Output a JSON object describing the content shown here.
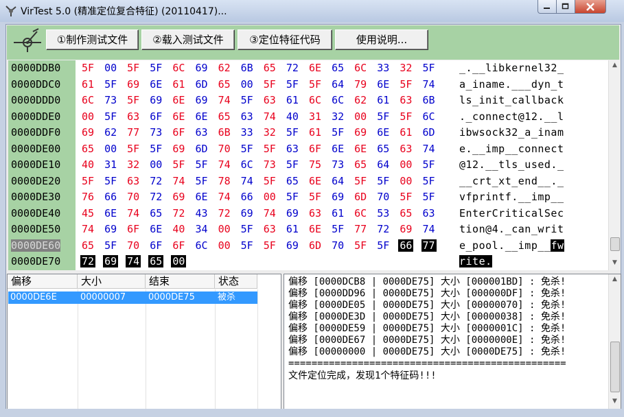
{
  "window": {
    "title": "VirTest 5.0 (精准定位复合特征) (20110417)..."
  },
  "toolbar": {
    "buttons": [
      "①制作测试文件",
      "②载入测试文件",
      "③定位特征代码",
      "使用说明..."
    ]
  },
  "hex": {
    "rows": [
      {
        "addr": "0000DDB0",
        "bytes": [
          "5F",
          "00",
          "5F",
          "5F",
          "6C",
          "69",
          "62",
          "6B",
          "65",
          "72",
          "6E",
          "65",
          "6C",
          "33",
          "32",
          "5F"
        ],
        "ascii": "_.__libkernel32_"
      },
      {
        "addr": "0000DDC0",
        "bytes": [
          "61",
          "5F",
          "69",
          "6E",
          "61",
          "6D",
          "65",
          "00",
          "5F",
          "5F",
          "5F",
          "64",
          "79",
          "6E",
          "5F",
          "74"
        ],
        "ascii": "a_iname.___dyn_t"
      },
      {
        "addr": "0000DDD0",
        "bytes": [
          "6C",
          "73",
          "5F",
          "69",
          "6E",
          "69",
          "74",
          "5F",
          "63",
          "61",
          "6C",
          "6C",
          "62",
          "61",
          "63",
          "6B"
        ],
        "ascii": "ls_init_callback"
      },
      {
        "addr": "0000DDE0",
        "bytes": [
          "00",
          "5F",
          "63",
          "6F",
          "6E",
          "6E",
          "65",
          "63",
          "74",
          "40",
          "31",
          "32",
          "00",
          "5F",
          "5F",
          "6C"
        ],
        "ascii": "._connect@12.__l"
      },
      {
        "addr": "0000DDF0",
        "bytes": [
          "69",
          "62",
          "77",
          "73",
          "6F",
          "63",
          "6B",
          "33",
          "32",
          "5F",
          "61",
          "5F",
          "69",
          "6E",
          "61",
          "6D"
        ],
        "ascii": "ibwsock32_a_inam"
      },
      {
        "addr": "0000DE00",
        "bytes": [
          "65",
          "00",
          "5F",
          "5F",
          "69",
          "6D",
          "70",
          "5F",
          "5F",
          "63",
          "6F",
          "6E",
          "6E",
          "65",
          "63",
          "74"
        ],
        "ascii": "e.__imp__connect"
      },
      {
        "addr": "0000DE10",
        "bytes": [
          "40",
          "31",
          "32",
          "00",
          "5F",
          "5F",
          "74",
          "6C",
          "73",
          "5F",
          "75",
          "73",
          "65",
          "64",
          "00",
          "5F"
        ],
        "ascii": "@12.__tls_used._"
      },
      {
        "addr": "0000DE20",
        "bytes": [
          "5F",
          "5F",
          "63",
          "72",
          "74",
          "5F",
          "78",
          "74",
          "5F",
          "65",
          "6E",
          "64",
          "5F",
          "5F",
          "00",
          "5F"
        ],
        "ascii": "__crt_xt_end__._"
      },
      {
        "addr": "0000DE30",
        "bytes": [
          "76",
          "66",
          "70",
          "72",
          "69",
          "6E",
          "74",
          "66",
          "00",
          "5F",
          "5F",
          "69",
          "6D",
          "70",
          "5F",
          "5F"
        ],
        "ascii": "vfprintf.__imp__"
      },
      {
        "addr": "0000DE40",
        "bytes": [
          "45",
          "6E",
          "74",
          "65",
          "72",
          "43",
          "72",
          "69",
          "74",
          "69",
          "63",
          "61",
          "6C",
          "53",
          "65",
          "63"
        ],
        "ascii": "EnterCriticalSec"
      },
      {
        "addr": "0000DE50",
        "bytes": [
          "74",
          "69",
          "6F",
          "6E",
          "40",
          "34",
          "00",
          "5F",
          "63",
          "61",
          "6E",
          "5F",
          "77",
          "72",
          "69",
          "74"
        ],
        "ascii": "tion@4._can_writ"
      },
      {
        "addr": "0000DE60",
        "bytes": [
          "65",
          "5F",
          "70",
          "6F",
          "6F",
          "6C",
          "00",
          "5F",
          "5F",
          "69",
          "6D",
          "70",
          "5F",
          "5F",
          "66",
          "77"
        ],
        "ascii": "e_pool.__imp__fw",
        "selected": true,
        "hl_from": 14
      },
      {
        "addr": "0000DE70",
        "bytes": [
          "72",
          "69",
          "74",
          "65",
          "00"
        ],
        "ascii": "rite.",
        "hl_from": 0
      }
    ],
    "colors": {
      "odd": "#e8001c",
      "even": "#0000cc",
      "panel": "#a7d2a4"
    }
  },
  "list": {
    "headers": [
      "偏移",
      "大小",
      "结束",
      "状态"
    ],
    "rows": [
      {
        "offset": "0000DE6E",
        "size": "00000007",
        "end": "0000DE75",
        "status": "被杀"
      }
    ]
  },
  "log": {
    "lines": [
      "偏移 [0000DCB8 | 0000DE75] 大小 [000001BD] : 免杀!",
      "偏移 [0000DD96 | 0000DE75] 大小 [000000DF] : 免杀!",
      "偏移 [0000DE05 | 0000DE75] 大小 [00000070] : 免杀!",
      "偏移 [0000DE3D | 0000DE75] 大小 [00000038] : 免杀!",
      "偏移 [0000DE59 | 0000DE75] 大小 [0000001C] : 免杀!",
      "偏移 [0000DE67 | 0000DE75] 大小 [0000000E] : 免杀!",
      "偏移 [00000000 | 0000DE75] 大小 [0000DE75] : 免杀!",
      "================================================",
      "文件定位完成，发现1个特征码!!!"
    ]
  }
}
